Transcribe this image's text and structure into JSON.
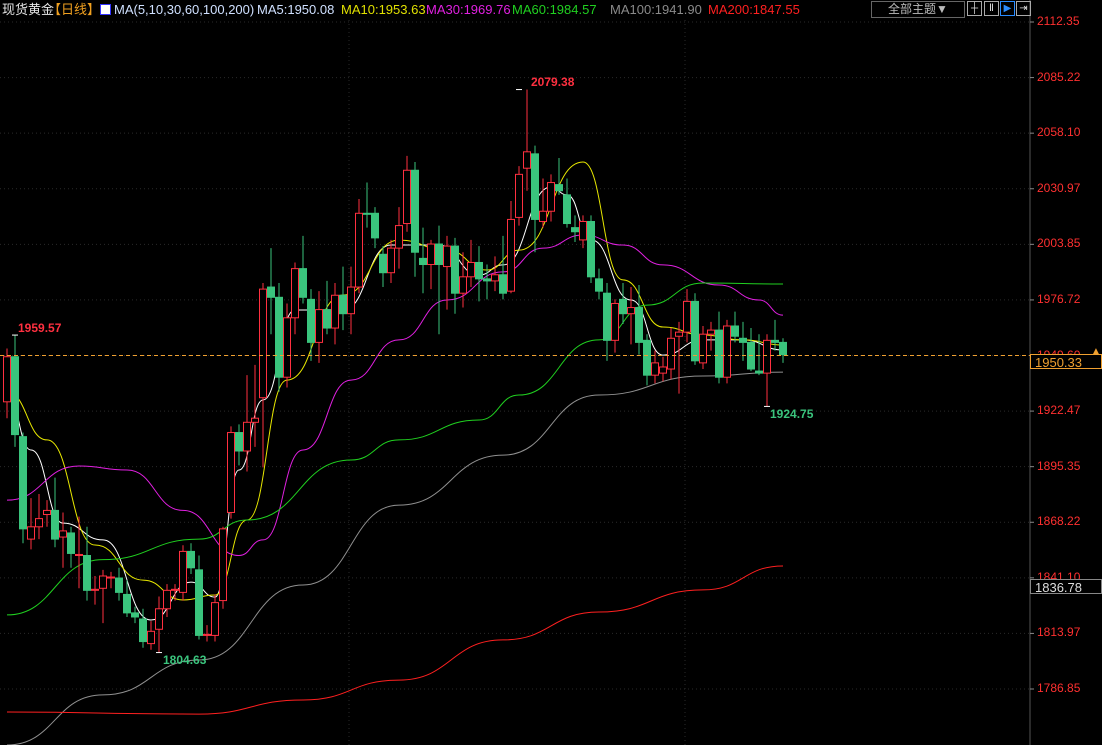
{
  "header": {
    "title": "现货黄金",
    "period": "【日线】",
    "ma_params": "MA(5,10,30,60,100,200)",
    "ma5": "MA5:1950.08",
    "ma10": "MA10:1953.63",
    "ma30": "MA30:1969.76",
    "ma60": "MA60:1984.57",
    "ma100": "MA100:1941.90",
    "ma200": "MA200:1847.55",
    "theme_button": "全部主题▼",
    "tool_icons": [
      "crosshair-icon",
      "interval-icon",
      "play-icon",
      "exit-icon"
    ]
  },
  "colors": {
    "up": "#ff3040",
    "down": "#3ac47d",
    "ma5": "#ffffff",
    "ma10": "#e8e800",
    "ma30": "#e020e0",
    "ma60": "#20d020",
    "ma100": "#909090",
    "ma200": "#ff2020",
    "axis": "#ff3030"
  },
  "chart_data": {
    "type": "candlestick",
    "title": "现货黄金 日线",
    "ylim": [
      1786.85,
      2112.35
    ],
    "y_ticks": [
      "2112.35",
      "2085.22",
      "2058.10",
      "2030.97",
      "2003.85",
      "1976.72",
      "1949.60",
      "1922.47",
      "1895.35",
      "1868.22",
      "1841.10",
      "1813.97",
      "1786.85"
    ],
    "current_price": "1950.33",
    "reference_line": 1949.6,
    "cursor_price": "1836.78",
    "annotations": {
      "high_left": "1959.57",
      "high": "2079.38",
      "low": "1804.63",
      "low_right": "1924.75"
    },
    "candles": [
      [
        1927,
        1953,
        1919,
        1949
      ],
      [
        1949,
        1959.57,
        1905,
        1911
      ],
      [
        1910,
        1912,
        1858,
        1865
      ],
      [
        1860,
        1880,
        1855,
        1866
      ],
      [
        1866,
        1882,
        1860,
        1870
      ],
      [
        1872,
        1879,
        1866,
        1874
      ],
      [
        1874,
        1890,
        1856,
        1860
      ],
      [
        1861,
        1873,
        1846,
        1864
      ],
      [
        1863,
        1866,
        1846,
        1853
      ],
      [
        1852,
        1871,
        1836,
        1852.5
      ],
      [
        1852,
        1866,
        1830,
        1835
      ],
      [
        1835,
        1842,
        1828,
        1835.5
      ],
      [
        1836,
        1845,
        1819,
        1842
      ],
      [
        1841,
        1844,
        1836,
        1841.5
      ],
      [
        1841,
        1846,
        1830,
        1834
      ],
      [
        1833,
        1840,
        1822,
        1824
      ],
      [
        1824,
        1827,
        1819,
        1822
      ],
      [
        1821,
        1826,
        1807,
        1810
      ],
      [
        1809,
        1820,
        1806,
        1815
      ],
      [
        1816,
        1832,
        1804.63,
        1826
      ],
      [
        1826,
        1838,
        1822,
        1835
      ],
      [
        1835,
        1838,
        1830,
        1835.5
      ],
      [
        1834,
        1857,
        1830,
        1854
      ],
      [
        1854,
        1858,
        1843,
        1846
      ],
      [
        1845,
        1852,
        1811,
        1813
      ],
      [
        1813,
        1818,
        1810,
        1813.5
      ],
      [
        1813,
        1833,
        1810,
        1829
      ],
      [
        1830,
        1866,
        1826,
        1865
      ],
      [
        1873,
        1915,
        1870,
        1912
      ],
      [
        1912,
        1916,
        1896,
        1903
      ],
      [
        1903,
        1940,
        1893,
        1917
      ],
      [
        1917,
        1945,
        1905,
        1919
      ],
      [
        1929,
        1985,
        1895,
        1982
      ],
      [
        1983,
        2002,
        1960,
        1978
      ],
      [
        1978,
        1985,
        1932,
        1939
      ],
      [
        1939,
        1975,
        1934,
        1968
      ],
      [
        1968,
        1995,
        1960,
        1992
      ],
      [
        1992,
        2008,
        1975,
        1978
      ],
      [
        1977,
        1982,
        1947,
        1956
      ],
      [
        1956,
        1981,
        1946,
        1972
      ],
      [
        1972,
        1986,
        1960,
        1963
      ],
      [
        1963,
        1985,
        1955,
        1979
      ],
      [
        1979,
        1993,
        1962,
        1970
      ],
      [
        1970,
        1993,
        1960,
        1983
      ],
      [
        1983,
        2026,
        1980,
        2019
      ],
      [
        2019,
        2034,
        2012,
        2018.5
      ],
      [
        2019,
        2022,
        2002,
        2007
      ],
      [
        1999,
        2003,
        1983,
        1990
      ],
      [
        1990,
        2006,
        1985,
        2002
      ],
      [
        2002,
        2022,
        1992,
        2013
      ],
      [
        2014,
        2047,
        2010,
        2040
      ],
      [
        2040,
        2044,
        1988,
        2000
      ],
      [
        1997,
        2012,
        1980,
        1994
      ],
      [
        1994,
        2006,
        1982,
        2004
      ],
      [
        2004,
        2013,
        1960,
        1994
      ],
      [
        1993,
        2008,
        1972,
        2003
      ],
      [
        2003,
        2007,
        1970,
        1980
      ],
      [
        1980,
        2000,
        1973,
        1988
      ],
      [
        1988,
        2006,
        1983,
        1995
      ],
      [
        1995,
        2003,
        1976,
        1987
      ],
      [
        1987,
        1994,
        1977,
        1986
      ],
      [
        1986,
        1998,
        1981,
        1989
      ],
      [
        1989,
        2008,
        1977,
        1980
      ],
      [
        1981,
        2025,
        1980,
        2016
      ],
      [
        2017,
        2042,
        2013,
        2038
      ],
      [
        2041,
        2079.38,
        2030,
        2049
      ],
      [
        2048,
        2052,
        2000,
        2016
      ],
      [
        2015,
        2036,
        2012,
        2020
      ],
      [
        2020,
        2038,
        2015,
        2034
      ],
      [
        2033,
        2046,
        2028,
        2030
      ],
      [
        2028,
        2036,
        2012,
        2014
      ],
      [
        2012,
        2018,
        2005,
        2010
      ],
      [
        2006,
        2018,
        2002,
        2015
      ],
      [
        2015,
        2018,
        1985,
        1988
      ],
      [
        1987,
        1992,
        1977,
        1981
      ],
      [
        1980,
        1985,
        1947,
        1957
      ],
      [
        1957,
        1977,
        1951,
        1975
      ],
      [
        1977,
        1985,
        1965,
        1970
      ],
      [
        1970,
        1983,
        1955,
        1973
      ],
      [
        1973,
        1984,
        1950,
        1956
      ],
      [
        1957,
        1960,
        1935,
        1940
      ],
      [
        1940,
        1952,
        1936,
        1946
      ],
      [
        1941,
        1949,
        1937,
        1944
      ],
      [
        1943,
        1963,
        1938,
        1958
      ],
      [
        1959,
        1966,
        1931,
        1961
      ],
      [
        1961,
        1982,
        1956,
        1976
      ],
      [
        1976,
        1980,
        1945,
        1947
      ],
      [
        1946,
        1964,
        1943,
        1960
      ],
      [
        1960,
        1966,
        1952,
        1962
      ],
      [
        1962,
        1971,
        1936,
        1939
      ],
      [
        1939,
        1967,
        1936,
        1964
      ],
      [
        1964,
        1971,
        1956,
        1959
      ],
      [
        1958,
        1966,
        1947,
        1956
      ],
      [
        1956,
        1963,
        1942,
        1943
      ],
      [
        1942,
        1960,
        1940,
        1941
      ],
      [
        1941,
        1960,
        1924.75,
        1957
      ],
      [
        1957,
        1967,
        1952,
        1956
      ],
      [
        1956,
        1958,
        1946,
        1950
      ]
    ],
    "moving_averages": [
      {
        "name": "MA5",
        "color_key": "ma5",
        "points": [
          [
            0,
            1930.3
          ],
          [
            3,
            1903.5
          ],
          [
            7,
            1867.8
          ],
          [
            12,
            1859.6
          ],
          [
            18,
            1820.5
          ],
          [
            23,
            1839
          ],
          [
            26,
            1831.7
          ],
          [
            29,
            1893.7
          ],
          [
            32,
            1927.9
          ],
          [
            36,
            1971.8
          ],
          [
            42,
            1971.8
          ],
          [
            48,
            2003.5
          ],
          [
            54,
            2003.5
          ],
          [
            59,
            1988.9
          ],
          [
            62,
            1993.8
          ],
          [
            68,
            2031.8
          ],
          [
            70,
            2028
          ],
          [
            73,
            2006
          ],
          [
            78,
            1976.7
          ],
          [
            82,
            1949.8
          ],
          [
            87,
            1957.2
          ],
          [
            92,
            1957.2
          ],
          [
            97,
            1952.3
          ]
        ]
      },
      {
        "name": "MA10",
        "color_key": "ma10",
        "points": [
          [
            0,
            1931.8
          ],
          [
            5,
            1908.4
          ],
          [
            11,
            1857.1
          ],
          [
            17,
            1840
          ],
          [
            22,
            1830.3
          ],
          [
            26,
            1832.7
          ],
          [
            30,
            1869.3
          ],
          [
            35,
            1937.6
          ],
          [
            42,
            1979.1
          ],
          [
            49,
            2005.9
          ],
          [
            55,
            2001
          ],
          [
            60,
            1991.3
          ],
          [
            64,
            2001
          ],
          [
            72,
            2044
          ],
          [
            77,
            1986.5
          ],
          [
            82,
            1963.5
          ],
          [
            87,
            1959.6
          ],
          [
            92,
            1957.2
          ],
          [
            97,
            1954.7
          ]
        ]
      },
      {
        "name": "MA30",
        "color_key": "ma30",
        "points": [
          [
            0,
            1879
          ],
          [
            9,
            1895.7
          ],
          [
            15,
            1893.7
          ],
          [
            22,
            1874
          ],
          [
            29,
            1852
          ],
          [
            32,
            1859.6
          ],
          [
            37,
            1903.5
          ],
          [
            43,
            1937.6
          ],
          [
            49,
            1957.2
          ],
          [
            55,
            1976.7
          ],
          [
            62,
            1990.4
          ],
          [
            67,
            2002
          ],
          [
            72,
            2008.4
          ],
          [
            77,
            2003.5
          ],
          [
            82,
            1993.8
          ],
          [
            89,
            1984
          ],
          [
            94,
            1976.7
          ],
          [
            97,
            1969.3
          ]
        ]
      },
      {
        "name": "MA60",
        "color_key": "ma60",
        "points": [
          [
            0,
            1823
          ],
          [
            12,
            1850
          ],
          [
            24,
            1860
          ],
          [
            30,
            1869.3
          ],
          [
            43,
            1898.6
          ],
          [
            49,
            1908.4
          ],
          [
            59,
            1918.1
          ],
          [
            64,
            1930.3
          ],
          [
            74,
            1957.2
          ],
          [
            80,
            1974.2
          ],
          [
            87,
            1985
          ],
          [
            97,
            1984.5
          ]
        ]
      },
      {
        "name": "MA100",
        "color_key": "ma100",
        "points": [
          [
            0,
            1759.5
          ],
          [
            12,
            1784
          ],
          [
            24,
            1801
          ],
          [
            37,
            1837.6
          ],
          [
            49,
            1876.6
          ],
          [
            62,
            1901
          ],
          [
            74,
            1930.3
          ],
          [
            87,
            1939.6
          ],
          [
            97,
            1941.5
          ]
        ]
      },
      {
        "name": "MA200",
        "color_key": "ma200",
        "points": [
          [
            0,
            1775.6
          ],
          [
            24,
            1774.6
          ],
          [
            37,
            1781.5
          ],
          [
            49,
            1791.2
          ],
          [
            62,
            1810.8
          ],
          [
            74,
            1824.4
          ],
          [
            87,
            1835.2
          ],
          [
            97,
            1846.9
          ]
        ]
      }
    ]
  }
}
